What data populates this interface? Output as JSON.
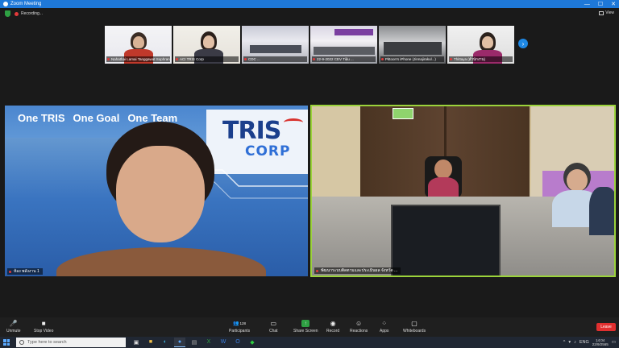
{
  "window": {
    "title": "Zoom Meeting",
    "minimize": "—",
    "maximize": "☐",
    "close": "✕"
  },
  "status": {
    "recording_label": "Recording...",
    "view_label": "View"
  },
  "thumbnails": [
    {
      "label": "Nahathai Lamai Tanggawat Sophrangkul ..."
    },
    {
      "label": "ACI TRIS Corp"
    },
    {
      "label": "CDC ..."
    },
    {
      "label": "22-9-2022 CEV Tiệu ..."
    },
    {
      "label": "Pittoon's iPhone (Jinnajirakul...)"
    },
    {
      "label": "Thittaya (สำนักงาน)"
    }
  ],
  "left_video": {
    "banner": [
      "One TRIS",
      "One Goal",
      "One Team"
    ],
    "logo_top": "TRIS",
    "logo_bottom": "CORP",
    "label": "ห้อง พลังงาน 1"
  },
  "right_video": {
    "label": "พัฒนาระบบติดตามและประเมินผล จังหวัด ..."
  },
  "toolbar": {
    "unmute": "Unmute",
    "stop_video": "Stop Video",
    "participants": "Participants",
    "participants_count": "128",
    "chat": "Chat",
    "share_screen": "Share Screen",
    "record": "Record",
    "reactions": "Reactions",
    "apps": "Apps",
    "whiteboards": "Whiteboards",
    "leave": "Leave"
  },
  "taskbar": {
    "search_placeholder": "Type here to search",
    "language": "ENG",
    "time": "14:04",
    "date": "22/9/2565"
  },
  "colors": {
    "accent": "#1e78d8",
    "active_speaker": "#9bd33b",
    "share_green": "#2ea043",
    "leave_red": "#e02f2f"
  }
}
